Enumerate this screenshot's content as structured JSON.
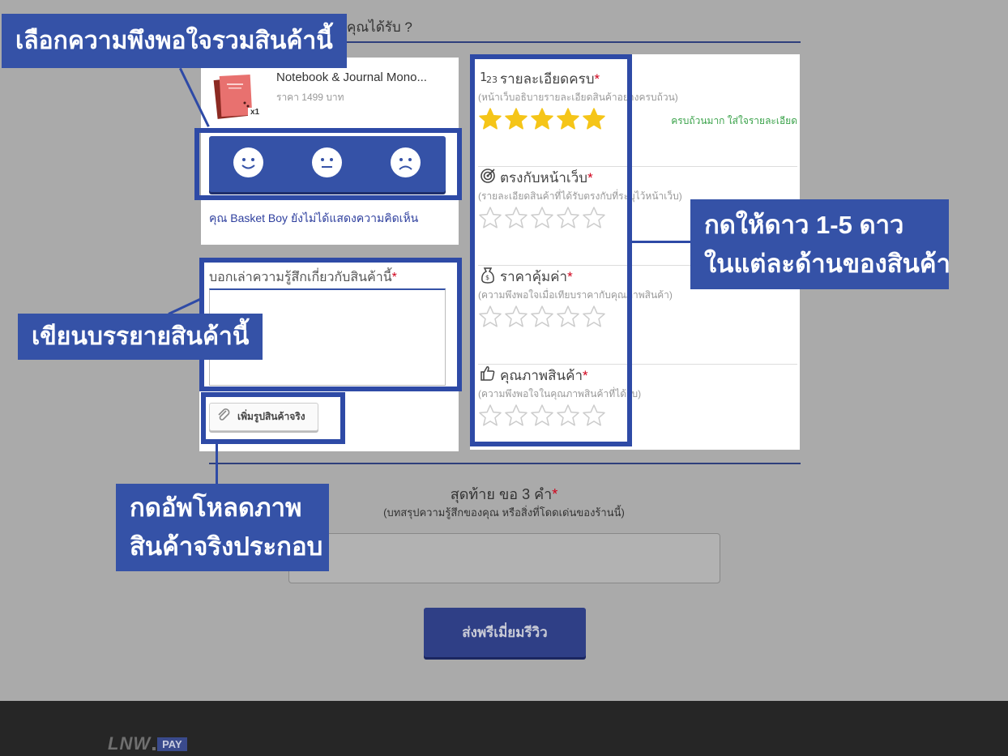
{
  "question_text": "คุณได้รับ ?",
  "product": {
    "name": "Notebook & Journal Mono...",
    "price": "ราคา 1499 บาท",
    "qty": "x1",
    "no_comment_text": "คุณ Basket Boy ยังไม่ได้แสดงความคิดเห็น"
  },
  "comment": {
    "label": "บอกเล่าความรู้สึกเกี่ยวกับสินค้านี้",
    "required_mark": "*",
    "value": "",
    "upload_label": "เพิ่มรูปสินค้าจริง"
  },
  "ratings": [
    {
      "title": "รายละเอียดครบ",
      "icon": "numbers-icon",
      "subtitle": "(หน้าเว็บอธิบายรายละเอียดสินค้าอย่างครบถ้วน)",
      "stars": 5,
      "max": 5,
      "feedback": "ครบถ้วนมาก ใส่ใจรายละเอียด"
    },
    {
      "title": "ตรงกับหน้าเว็บ",
      "icon": "target-icon",
      "subtitle": "(รายละเอียดสินค้าที่ได้รับตรงกับที่ระบุไว้หน้าเว็บ)",
      "stars": 0,
      "max": 5,
      "feedback": ""
    },
    {
      "title": "ราคาคุ้มค่า",
      "icon": "money-bag-icon",
      "subtitle": "(ความพึงพอใจเมื่อเทียบราคากับคุณภาพสินค้า)",
      "stars": 0,
      "max": 5,
      "feedback": ""
    },
    {
      "title": "คุณภาพสินค้า",
      "icon": "thumbs-up-icon",
      "subtitle": "(ความพึงพอใจในคุณภาพสินค้าที่ได้รับ)",
      "stars": 0,
      "max": 5,
      "feedback": ""
    }
  ],
  "final": {
    "title": "สุดท้าย ขอ 3 คำ",
    "required_mark": "*",
    "subtitle": "(บทสรุปความรู้สึกของคุณ หรือสิ่งที่โดดเด่นของร้านนี้)",
    "value": ""
  },
  "submit_label": "ส่งพรีเมี่ยมรีวิว",
  "footer": {
    "logo_main": "LNW",
    "logo_pay": "PAY"
  },
  "annotations": {
    "satisfaction": "เลือกความพึงพอใจรวมสินค้านี้",
    "stars_line1": "กดให้ดาว 1-5 ดาว",
    "stars_line2": "ในแต่ละด้านของสินค้า",
    "describe": "เขียนบรรยายสินค้านี้",
    "upload_line1": "กดอัพโหลดภาพ",
    "upload_line2": "สินค้าจริงประกอบ"
  },
  "colors": {
    "accent": "#3552a7",
    "required": "#d0021b",
    "star_filled": "#f5c518",
    "star_empty": "#cccccc",
    "feedback": "#3aa24a"
  }
}
